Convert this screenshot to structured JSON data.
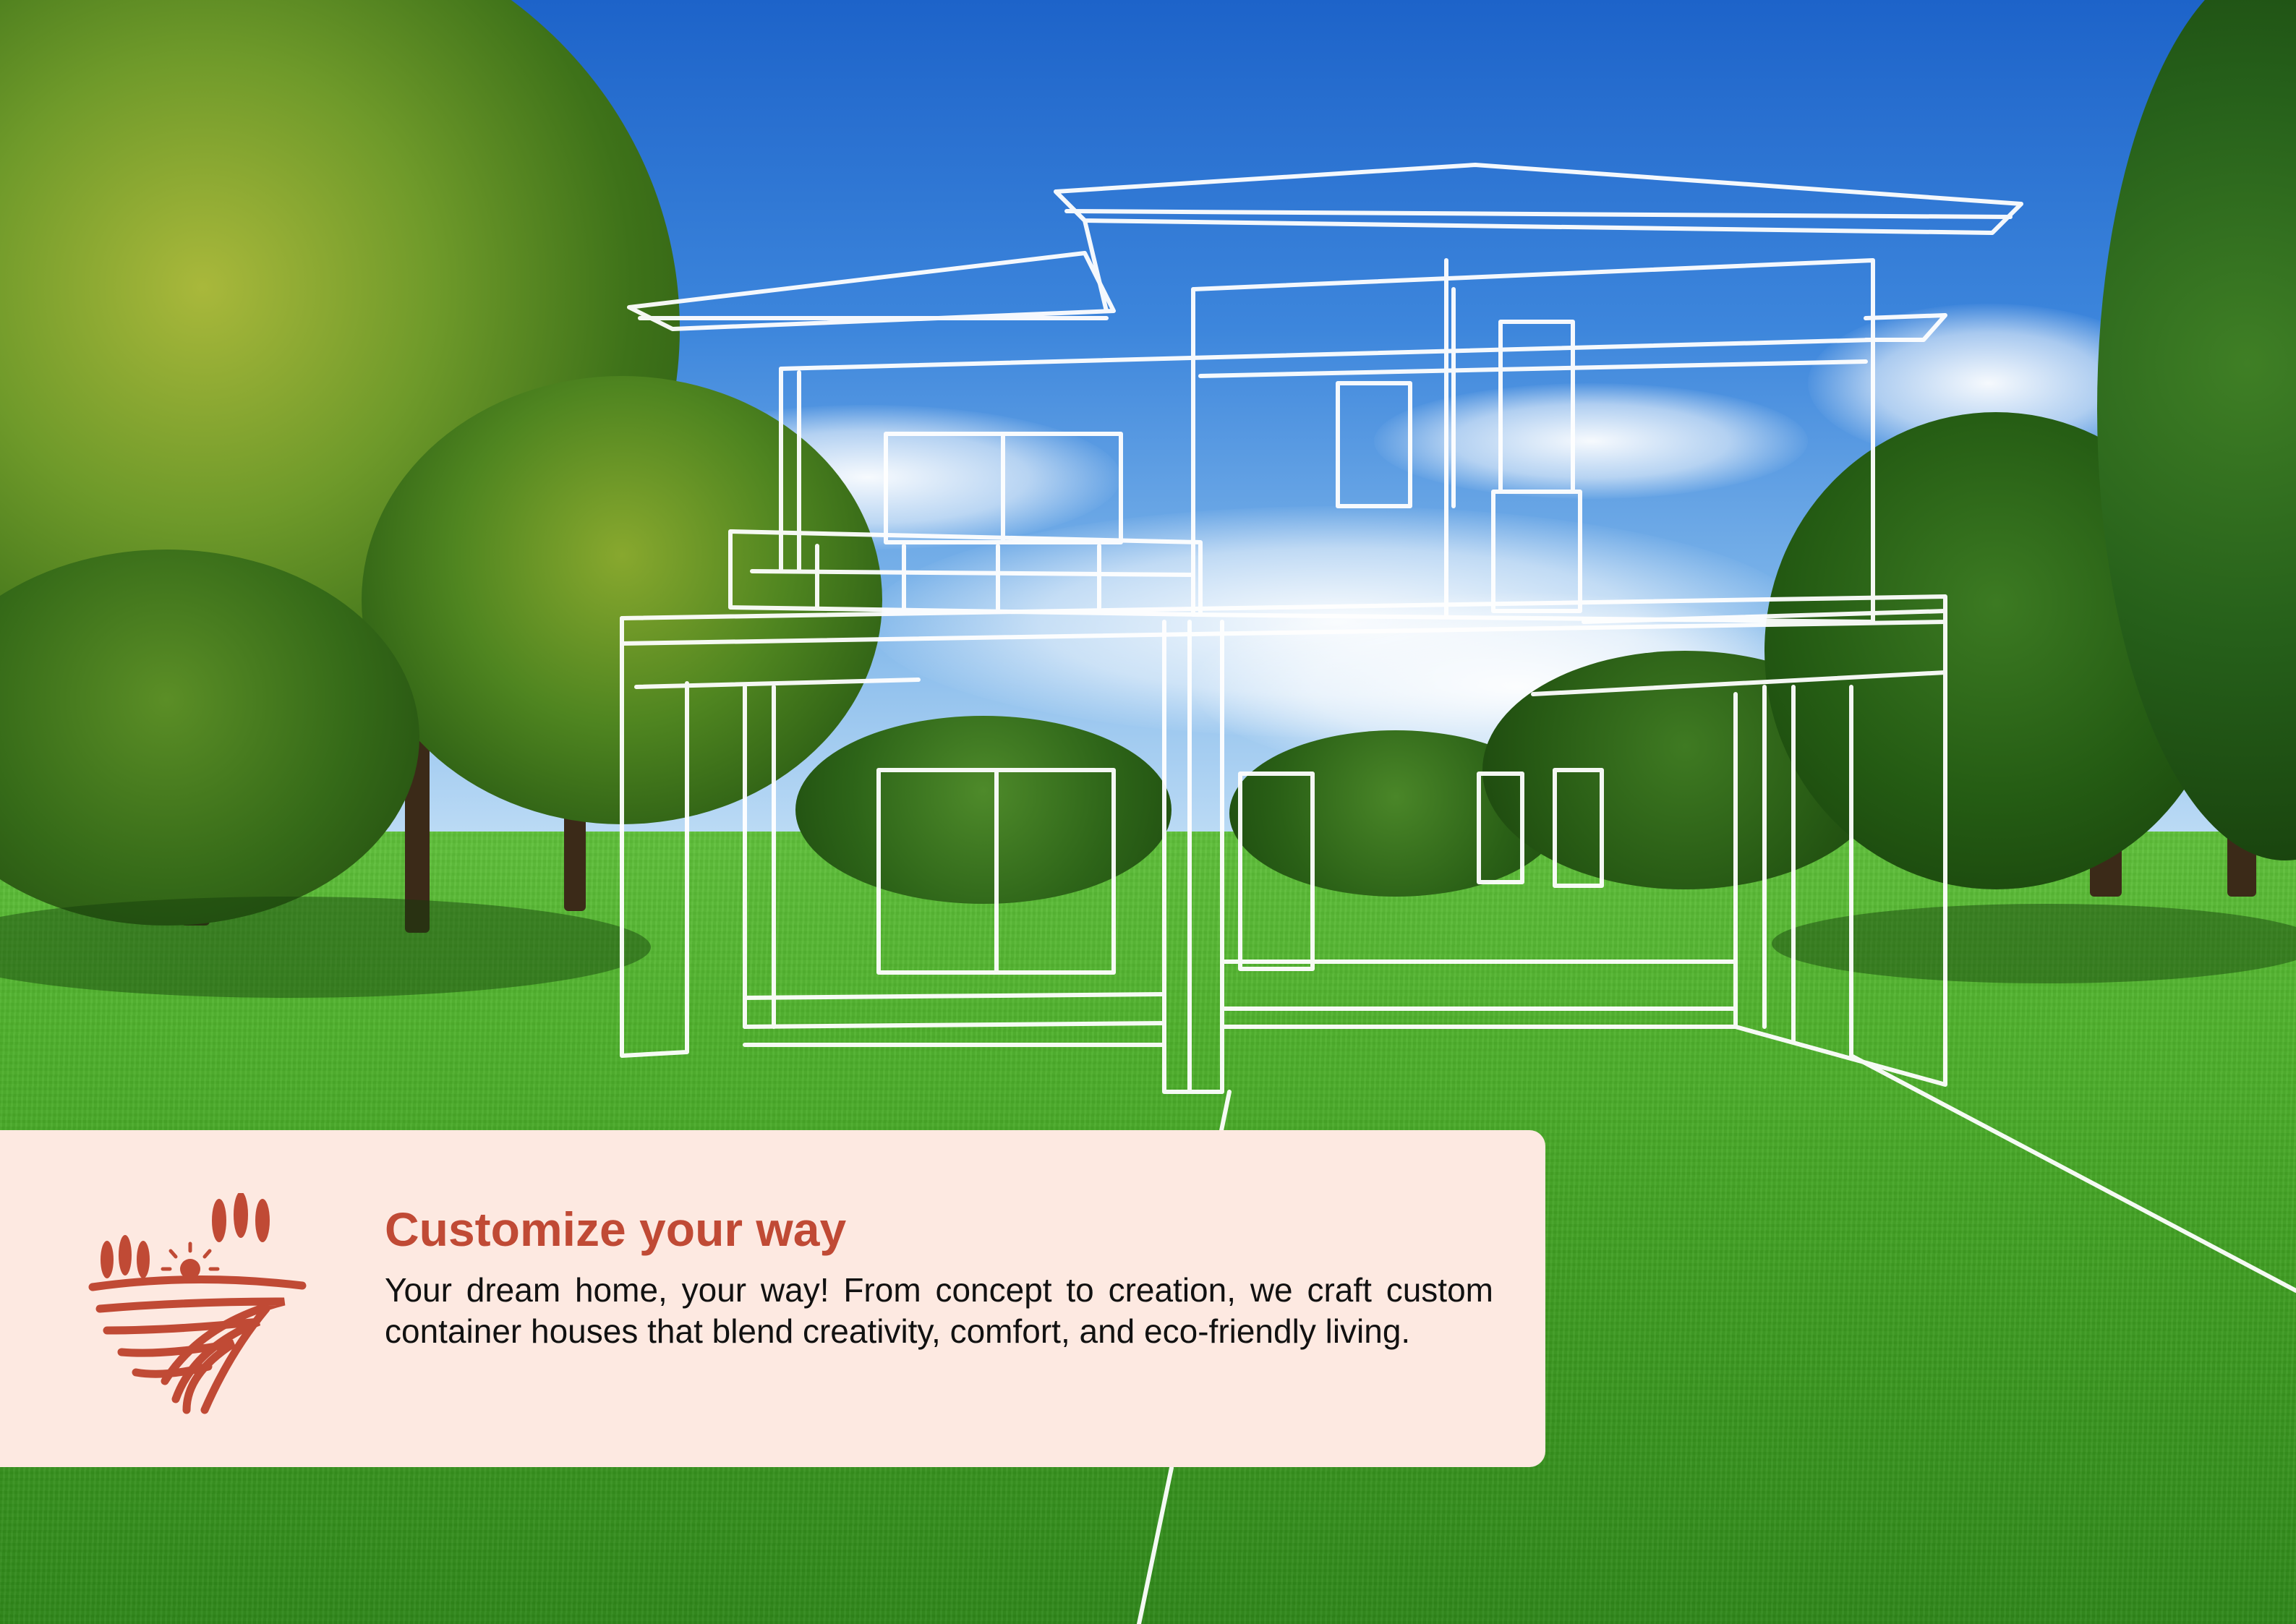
{
  "card": {
    "title": "Customize your way",
    "body": "Your dream home, your way! From concept to creation, we craft custom container houses that blend creativity, comfort, and eco-friendly living."
  },
  "colors": {
    "accent": "#c04a35",
    "card_background": "#fde9e1",
    "body_text": "#111111",
    "sky": "#2f77d6",
    "grass": "#4fb12c"
  },
  "icons": {
    "logo": "farm-field-sun-trees-icon"
  }
}
